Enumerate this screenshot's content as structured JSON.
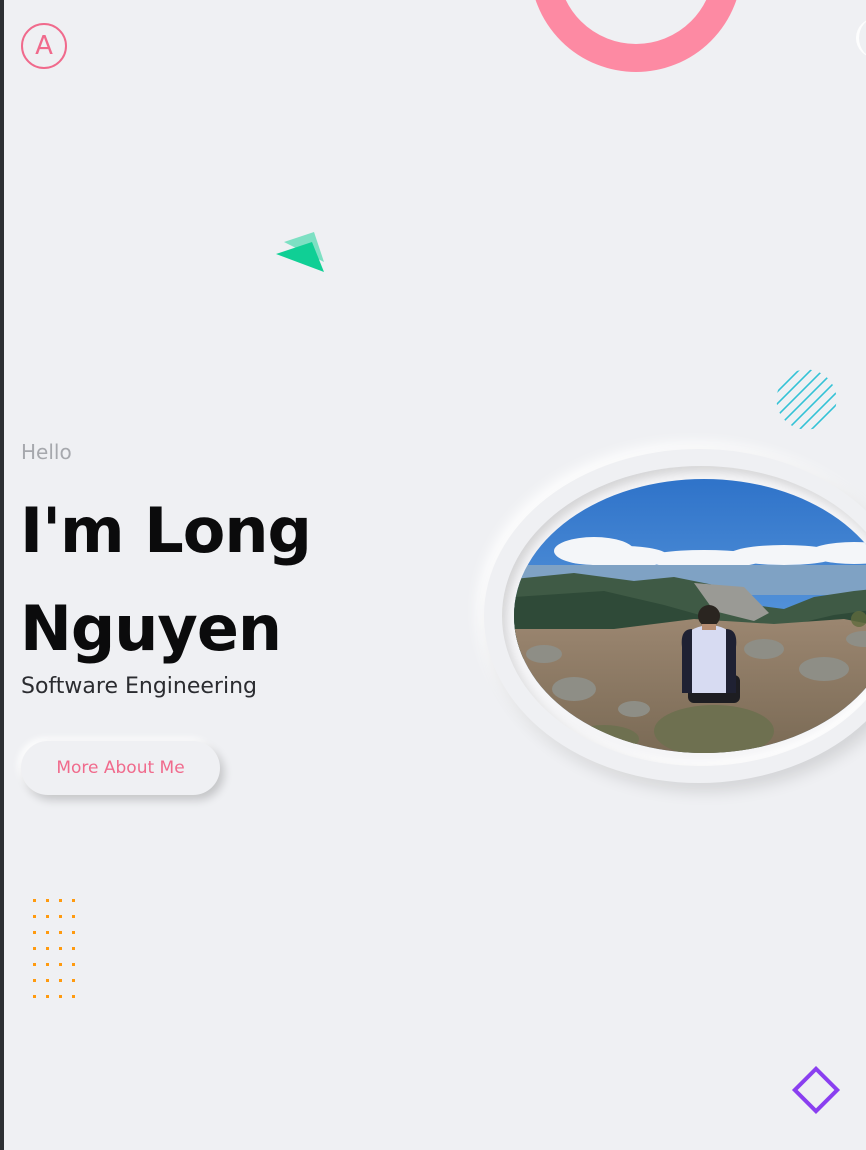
{
  "logo": {
    "letter": "A"
  },
  "hero": {
    "greeting": "Hello",
    "name": "I'm Long Nguyen",
    "role": "Software Engineering",
    "cta_label": "More About Me"
  },
  "colors": {
    "accent_pink": "#f06a8c",
    "ring_pink": "#fd8aa3",
    "triangle_green": "#1fd39a",
    "hatch_teal": "#33c2d6",
    "dots_orange": "#ff9a0e",
    "diamond_purple": "#8a3ff0",
    "background": "#eff0f3"
  },
  "decorations": [
    "ring-shape",
    "triangle-shape",
    "hatched-circle-shape",
    "dot-grid-shape",
    "diamond-shape"
  ],
  "profile_photo": {
    "subject": "person sitting on rocky mountain summit overlooking valley"
  }
}
